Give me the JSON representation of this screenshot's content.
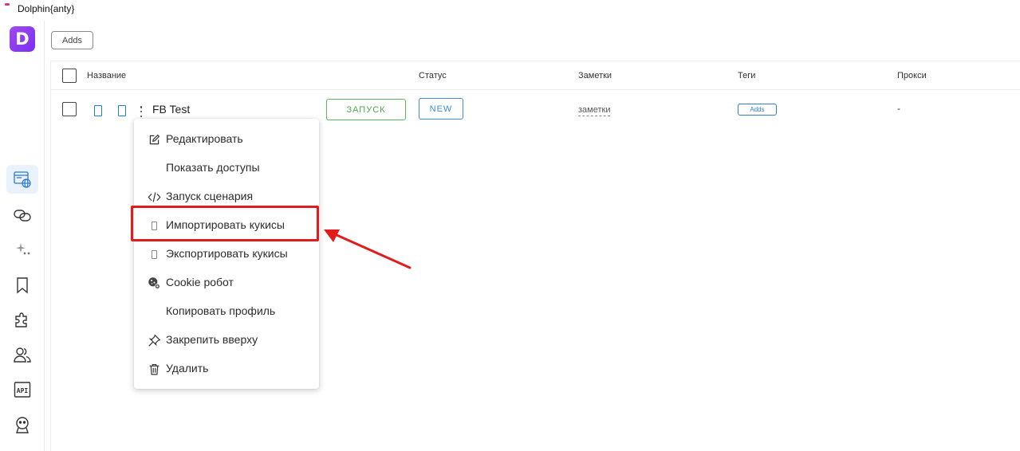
{
  "window": {
    "title": "Dolphin{anty}"
  },
  "sidebar": {
    "logo_letter": "D",
    "items": [
      {
        "icon": "browser-profiles-icon",
        "active": true
      },
      {
        "icon": "link-icon"
      },
      {
        "icon": "sparkles-icon"
      },
      {
        "icon": "bookmark-icon"
      },
      {
        "icon": "puzzle-icon"
      },
      {
        "icon": "users-icon"
      },
      {
        "icon": "api-icon",
        "text": "API"
      },
      {
        "icon": "robot-icon"
      }
    ]
  },
  "toolbar": {
    "adds_button": "Adds"
  },
  "table": {
    "columns": {
      "name": "Название",
      "status": "Статус",
      "notes": "Заметки",
      "tags": "Теги",
      "proxy": "Прокси"
    },
    "rows": [
      {
        "name": "FB Test",
        "start_button": "ЗАПУСК",
        "status": "NEW",
        "notes": "заметки",
        "tag": "Adds",
        "proxy": "-"
      }
    ]
  },
  "context_menu": {
    "items": [
      {
        "label": "Редактировать",
        "icon": "edit-icon"
      },
      {
        "label": "Показать доступы",
        "icon": ""
      },
      {
        "label": "Запуск сценария",
        "icon": "code-icon"
      },
      {
        "label": "Импортировать кукисы",
        "icon": "import-cookies-icon",
        "highlighted": true
      },
      {
        "label": "Экспортировать кукисы",
        "icon": "export-cookies-icon"
      },
      {
        "label": "Cookie робот",
        "icon": "cookie-robot-icon"
      },
      {
        "label": "Копировать профиль",
        "icon": ""
      },
      {
        "label": "Закрепить вверху",
        "icon": "pin-icon"
      },
      {
        "label": "Удалить",
        "icon": "trash-icon"
      }
    ]
  },
  "colors": {
    "highlight": "#e21b1b",
    "accent": "#3d8fd8",
    "start_green": "#4aa652",
    "logo": "#8a3df0"
  }
}
